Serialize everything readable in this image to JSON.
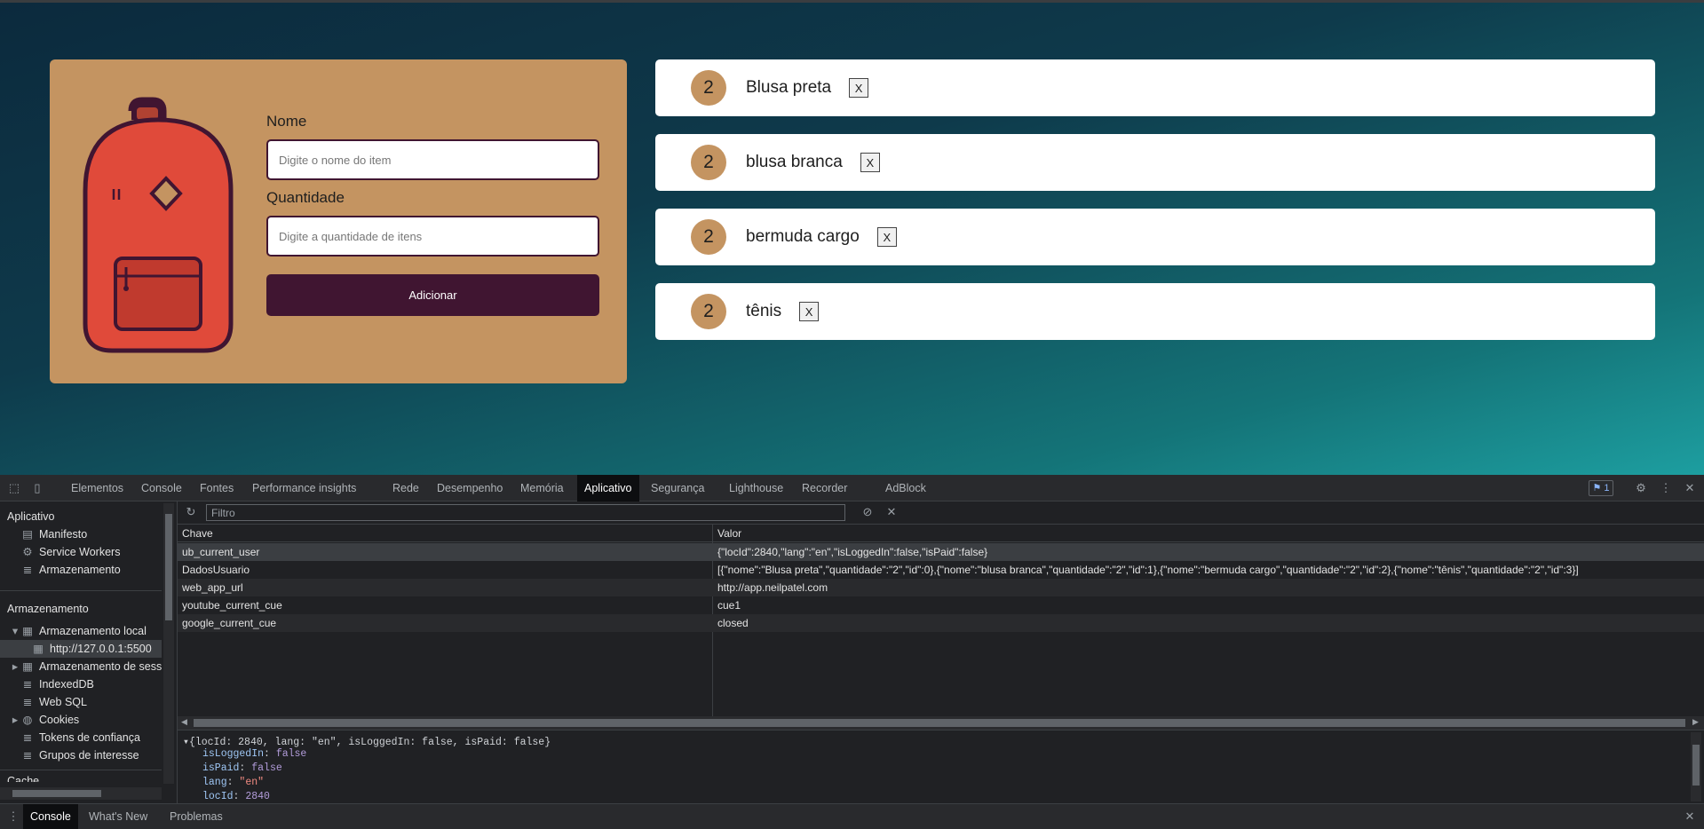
{
  "form": {
    "name_label": "Nome",
    "name_placeholder": "Digite o nome do item",
    "qty_label": "Quantidade",
    "qty_placeholder": "Digite a quantidade de itens",
    "add_label": "Adicionar"
  },
  "items": [
    {
      "qty": "2",
      "name": "Blusa preta",
      "delete": "X"
    },
    {
      "qty": "2",
      "name": "blusa branca",
      "delete": "X"
    },
    {
      "qty": "2",
      "name": "bermuda cargo",
      "delete": "X"
    },
    {
      "qty": "2",
      "name": "tênis",
      "delete": "X"
    }
  ],
  "devtools": {
    "tabs": [
      "Elementos",
      "Console",
      "Fontes",
      "Performance insights",
      "Rede",
      "Desempenho",
      "Memória",
      "Aplicativo",
      "Segurança",
      "Lighthouse",
      "Recorder",
      "AdBlock"
    ],
    "active_tab": "Aplicativo",
    "issues_count": "1",
    "sidebar": {
      "app_heading": "Aplicativo",
      "manifest": "Manifesto",
      "service_workers": "Service Workers",
      "storage_item": "Armazenamento",
      "storage_heading": "Armazenamento",
      "local_storage": "Armazenamento local",
      "local_origin": "http://127.0.0.1:5500",
      "session_storage": "Armazenamento de sessão",
      "indexeddb": "IndexedDB",
      "websql": "Web SQL",
      "cookies": "Cookies",
      "trust_tokens": "Tokens de confiança",
      "interest_groups": "Grupos de interesse",
      "cache_heading": "Cache"
    },
    "filter_placeholder": "Filtro",
    "columns": {
      "key": "Chave",
      "value": "Valor"
    },
    "rows": [
      {
        "key": "ub_current_user",
        "value": "{\"locId\":2840,\"lang\":\"en\",\"isLoggedIn\":false,\"isPaid\":false}"
      },
      {
        "key": "DadosUsuario",
        "value": "[{\"nome\":\"Blusa preta\",\"quantidade\":\"2\",\"id\":0},{\"nome\":\"blusa branca\",\"quantidade\":\"2\",\"id\":1},{\"nome\":\"bermuda cargo\",\"quantidade\":\"2\",\"id\":2},{\"nome\":\"tênis\",\"quantidade\":\"2\",\"id\":3}]"
      },
      {
        "key": "web_app_url",
        "value": "http://app.neilpatel.com"
      },
      {
        "key": "youtube_current_cue",
        "value": "cue1"
      },
      {
        "key": "google_current_cue",
        "value": "closed"
      }
    ],
    "preview": {
      "summary": "{locId: 2840, lang: \"en\", isLoggedIn: false, isPaid: false}",
      "props": [
        {
          "k": "isLoggedIn",
          "v": "false"
        },
        {
          "k": "isPaid",
          "v": "false"
        },
        {
          "k": "lang",
          "v": "\"en\""
        },
        {
          "k": "locId",
          "v": "2840"
        }
      ]
    },
    "drawer_tabs": [
      "Console",
      "What's New",
      "Problemas"
    ],
    "drawer_active": "Console"
  },
  "colors": {
    "card": "#c49461",
    "button": "#401531",
    "devtools_bg": "#202124"
  }
}
